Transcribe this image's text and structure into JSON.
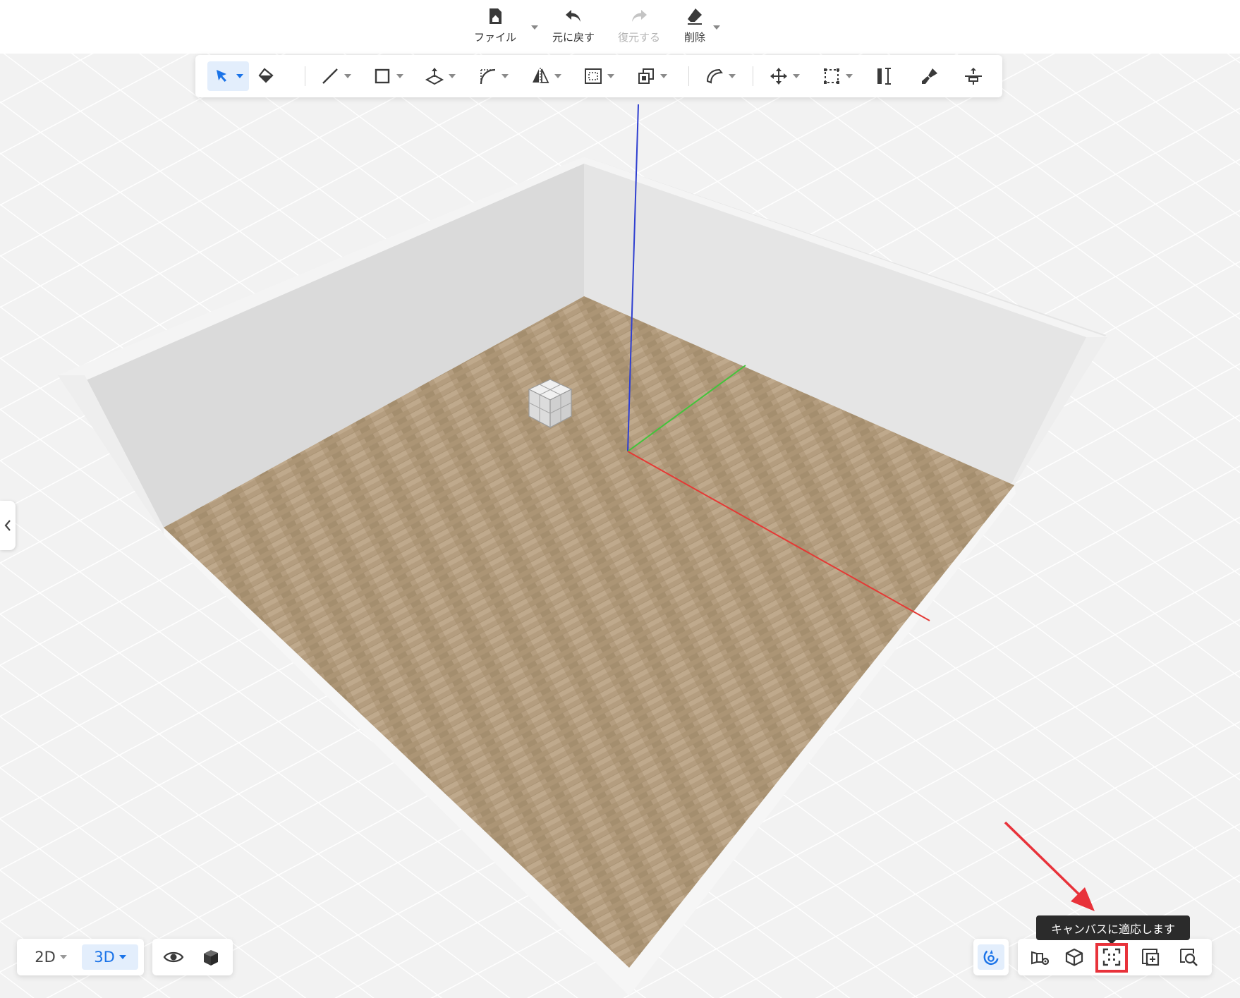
{
  "top_menu": {
    "file": {
      "label": "ファイル",
      "icon": "file-house-icon"
    },
    "undo": {
      "label": "元に戻す",
      "icon": "undo-arrow-icon"
    },
    "redo": {
      "label": "復元する",
      "icon": "redo-arrow-icon"
    },
    "delete": {
      "label": "削除",
      "icon": "eraser-icon"
    }
  },
  "toolbar": {
    "tools": [
      {
        "id": "select",
        "icon": "cursor-arrow-icon",
        "active": true
      },
      {
        "id": "paint",
        "icon": "paint-bucket-icon"
      },
      {
        "id": "line",
        "icon": "line-icon"
      },
      {
        "id": "rectangle",
        "icon": "square-icon"
      },
      {
        "id": "push-pull",
        "icon": "push-pull-icon"
      },
      {
        "id": "arc",
        "icon": "arc-icon"
      },
      {
        "id": "mirror",
        "icon": "mirror-icon"
      },
      {
        "id": "offset",
        "icon": "offset-icon"
      },
      {
        "id": "copy",
        "icon": "copy-icon"
      },
      {
        "id": "follow-me",
        "icon": "follow-me-icon"
      },
      {
        "id": "move",
        "icon": "move-icon"
      },
      {
        "id": "array",
        "icon": "array-icon"
      },
      {
        "id": "measure",
        "icon": "measure-icon"
      },
      {
        "id": "material-brush",
        "icon": "brush-icon"
      },
      {
        "id": "align",
        "icon": "align-icon"
      }
    ]
  },
  "view_mode": {
    "options": [
      "2D",
      "3D"
    ],
    "selected": "3D"
  },
  "display_controls": {
    "visibility_icon": "eye-icon",
    "box_icon": "cube-icon"
  },
  "snap": {
    "icon": "magnet-icon",
    "active": true
  },
  "camera_controls": {
    "buttons": [
      {
        "id": "camera-settings",
        "icon": "camera-settings-icon"
      },
      {
        "id": "standard-views",
        "icon": "cube-outline-icon"
      },
      {
        "id": "fit-to-canvas",
        "icon": "fit-canvas-icon",
        "tooltip": "キャンバスに適応します",
        "highlighted": true
      },
      {
        "id": "zoom-window",
        "icon": "zoom-window-icon"
      },
      {
        "id": "zoom-search",
        "icon": "zoom-search-icon"
      }
    ]
  },
  "tooltip": {
    "text": "キャンバスに適応します"
  },
  "colors": {
    "accent": "#1a73e8",
    "highlight": "#e8323a",
    "axis_x": "#e53935",
    "axis_y": "#43c43b",
    "axis_z": "#2f3fd0",
    "floor": "#b09a7c",
    "wall": "#dcdcdc"
  }
}
